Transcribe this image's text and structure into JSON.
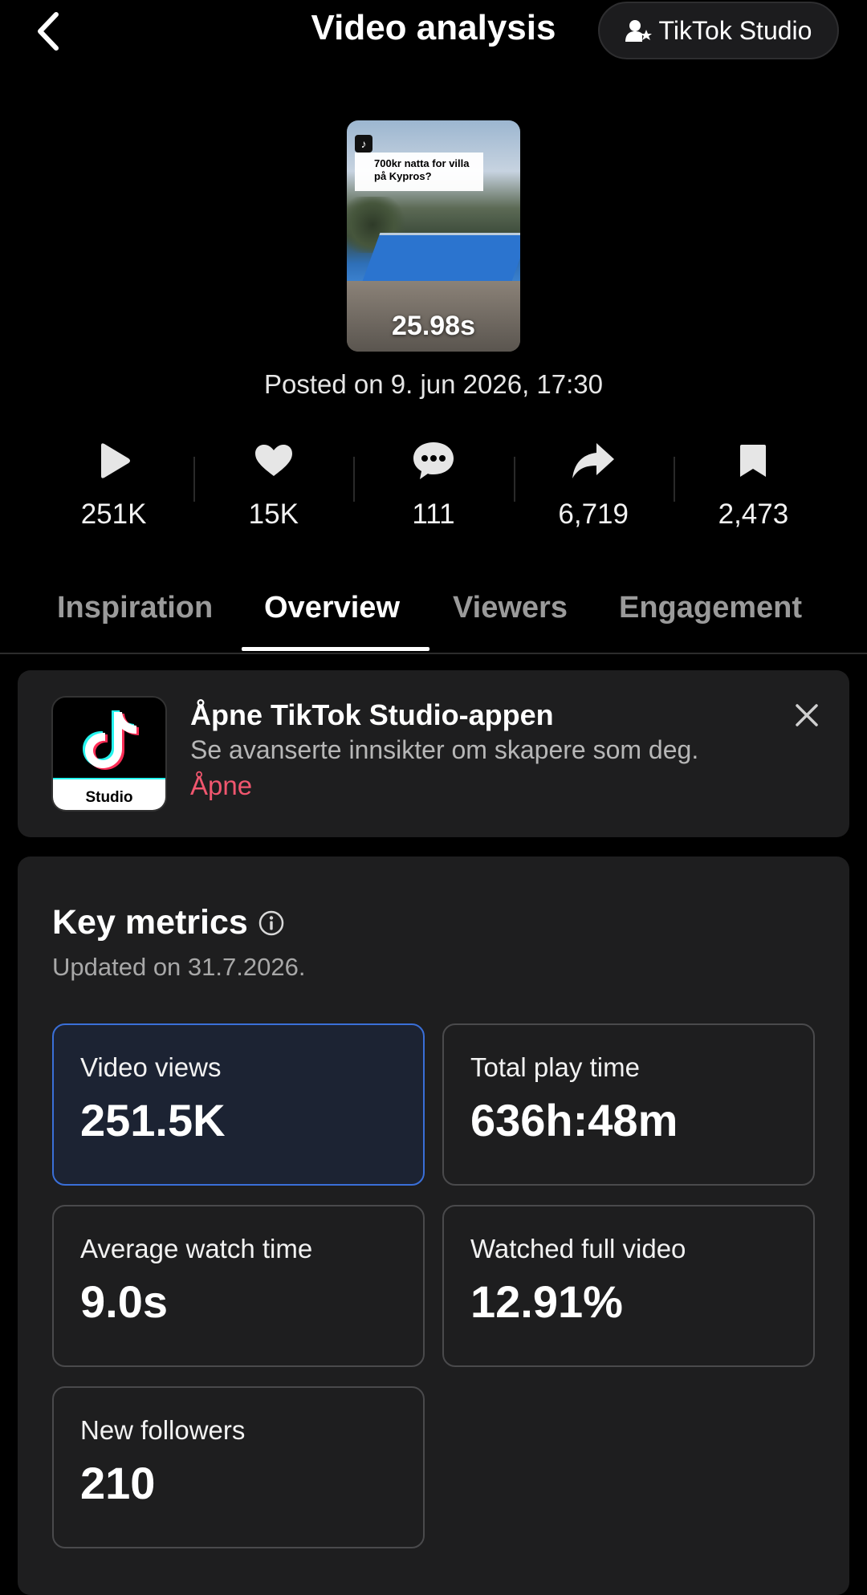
{
  "header": {
    "title": "Video analysis",
    "studio_button": "TikTok Studio"
  },
  "video": {
    "caption": "700kr natta for villa på Kypros?",
    "duration": "25.98s",
    "posted": "Posted on 9. jun 2026, 17:30"
  },
  "stats": [
    {
      "icon": "play-icon",
      "value": "251K"
    },
    {
      "icon": "heart-icon",
      "value": "15K"
    },
    {
      "icon": "comment-icon",
      "value": "111"
    },
    {
      "icon": "share-icon",
      "value": "6,719"
    },
    {
      "icon": "bookmark-icon",
      "value": "2,473"
    }
  ],
  "tabs": [
    {
      "label": "Inspiration"
    },
    {
      "label": "Overview",
      "active": true
    },
    {
      "label": "Viewers"
    },
    {
      "label": "Engagement"
    }
  ],
  "banner": {
    "app_icon_label": "Studio",
    "title": "Åpne TikTok Studio-appen",
    "description": "Se avanserte innsikter om skapere som deg.",
    "link": "Åpne"
  },
  "key_metrics": {
    "title": "Key metrics",
    "updated": "Updated on 31.7.2026.",
    "cards": [
      {
        "label": "Video views",
        "value": "251.5K",
        "selected": true
      },
      {
        "label": "Total play time",
        "value": "636h:48m"
      },
      {
        "label": "Average watch time",
        "value": "9.0s"
      },
      {
        "label": "Watched full video",
        "value": "12.91%"
      },
      {
        "label": "New followers",
        "value": "210"
      }
    ]
  },
  "colors": {
    "background": "#000000",
    "panel": "#1e1e1f",
    "link": "#f0566e",
    "selected_border": "#3a6fd8"
  }
}
